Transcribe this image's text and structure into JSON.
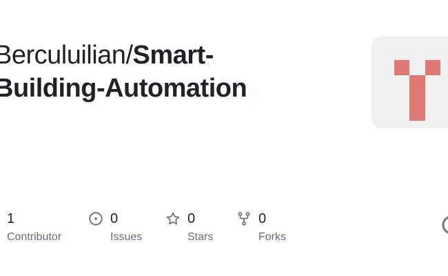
{
  "repo": {
    "owner": "Berculuilian/",
    "name": "Smart-\nBuilding-Automation"
  },
  "stats": [
    {
      "value": "1",
      "label": "Contributor",
      "icon": "people-icon"
    },
    {
      "value": "0",
      "label": "Issues",
      "icon": "issue-opened-icon"
    },
    {
      "value": "0",
      "label": "Stars",
      "icon": "star-icon"
    },
    {
      "value": "0",
      "label": "Forks",
      "icon": "repo-forked-icon"
    }
  ],
  "colors": {
    "avatar_bg": "#f0f0f0",
    "avatar_fg": "#de7a73",
    "text": "#1f2328",
    "muted": "#656d76"
  }
}
